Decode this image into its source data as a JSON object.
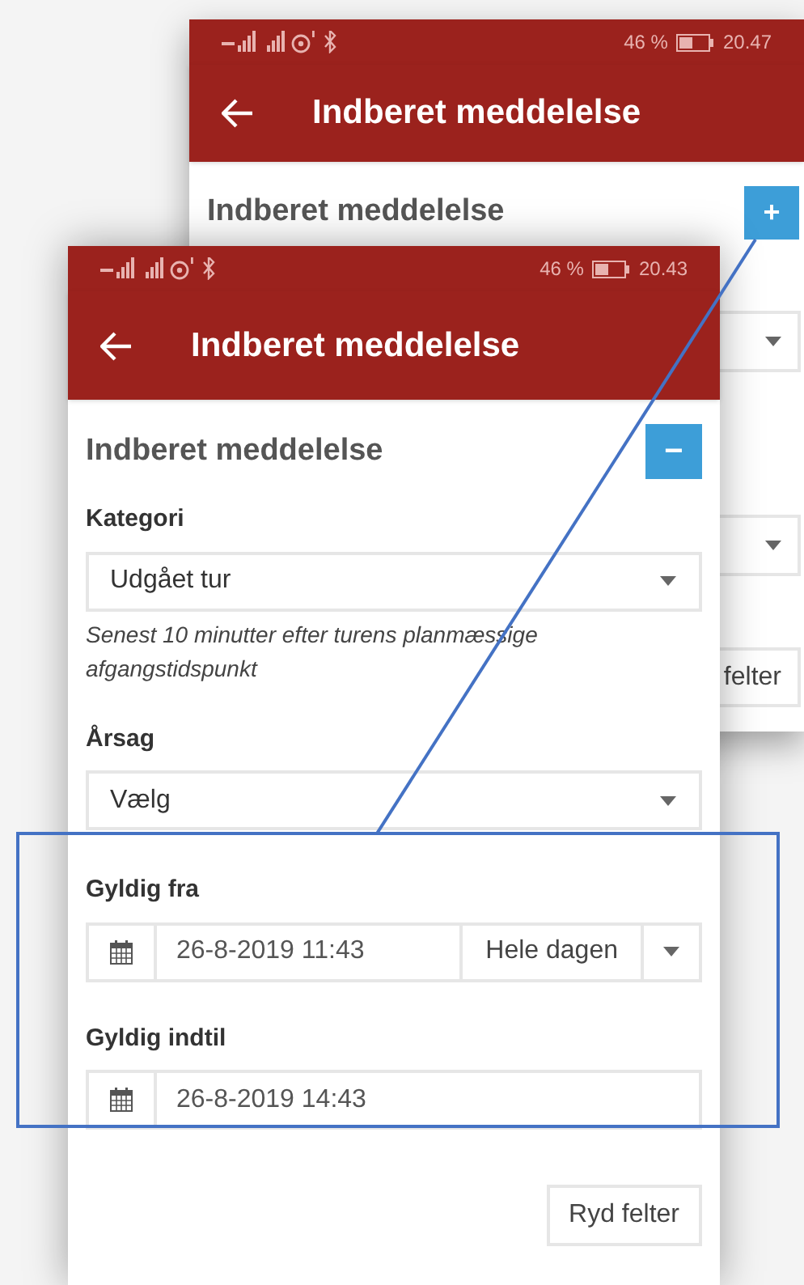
{
  "back_screen": {
    "status_bar": {
      "battery": "46 %",
      "time": "20.47"
    },
    "app_bar": {
      "title": "Indberet meddelelse"
    },
    "heading": "Indberet meddelelse",
    "toggle_button": {
      "label": "+"
    },
    "button_visible_text": "felter"
  },
  "front_screen": {
    "status_bar": {
      "battery": "46 %",
      "time": "20.43"
    },
    "app_bar": {
      "title": "Indberet meddelelse"
    },
    "heading": "Indberet meddelelse",
    "toggle_button": {
      "label": "−"
    },
    "fields": [
      {
        "kind": "select",
        "label": "Kategori",
        "value": "Udgået tur",
        "hint": "Senest 10 minutter efter turens planmæssige afgangstidspunkt"
      },
      {
        "kind": "select",
        "label": "Årsag",
        "value": "Vælg"
      },
      {
        "kind": "datetime",
        "label": "Gyldig fra",
        "value": "26-8-2019 11:43",
        "option": "Hele dagen"
      },
      {
        "kind": "datetime",
        "label": "Gyldig indtil",
        "value": "26-8-2019 14:43"
      }
    ],
    "clear_button": "Ryd felter"
  }
}
